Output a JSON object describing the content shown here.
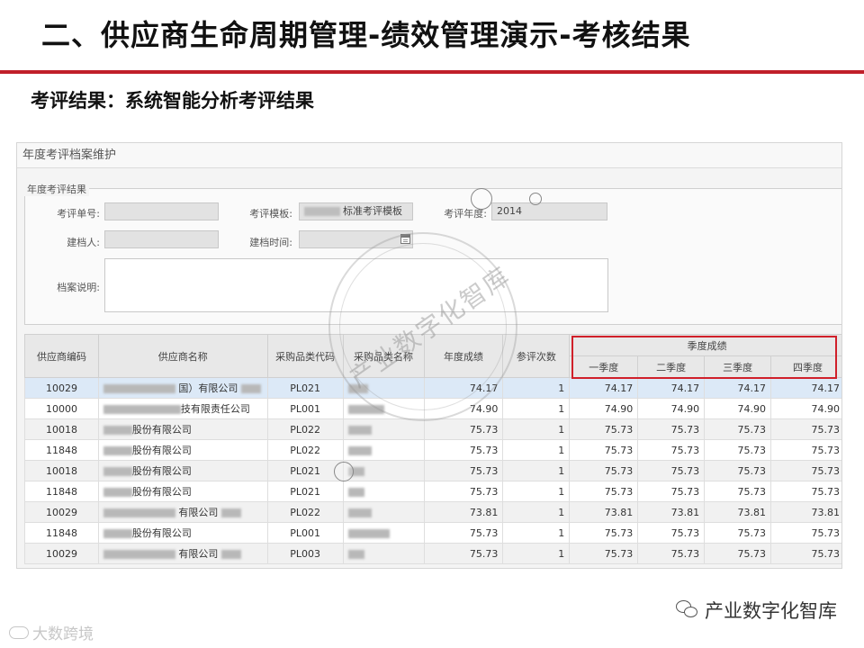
{
  "slide": {
    "title": "二、供应商生命周期管理-绩效管理演示-考核结果",
    "subtitle": "考评结果：系统智能分析考评结果"
  },
  "window": {
    "title": "年度考评档案维护",
    "section_legend": "年度考评结果"
  },
  "form": {
    "eval_no_label": "考评单号:",
    "eval_no_value": "",
    "template_label": "考评模板:",
    "template_value": "标准考评模板",
    "year_label": "考评年度:",
    "year_value": "2014",
    "creator_label": "建档人:",
    "creator_value": "",
    "created_time_label": "建档时间:",
    "created_time_value": "",
    "notes_label": "档案说明:",
    "notes_value": ""
  },
  "table": {
    "headers": {
      "supplier_code": "供应商编码",
      "supplier_name": "供应商名称",
      "category_code": "采购品类代码",
      "category_name": "采购品类名称",
      "annual_score": "年度成绩",
      "eval_count": "参评次数",
      "quarterly_group": "季度成绩",
      "q1": "一季度",
      "q2": "二季度",
      "q3": "三季度",
      "q4": "四季度"
    },
    "rows": [
      {
        "code": "10029",
        "name": "国）有限公司",
        "cat": "PL021",
        "annual": "74.17",
        "count": "1",
        "q1": "74.17",
        "q2": "74.17",
        "q3": "74.17",
        "q4": "74.17"
      },
      {
        "code": "10000",
        "name": "技有限责任公司",
        "cat": "PL001",
        "annual": "74.90",
        "count": "1",
        "q1": "74.90",
        "q2": "74.90",
        "q3": "74.90",
        "q4": "74.90"
      },
      {
        "code": "10018",
        "name": "股份有限公司",
        "cat": "PL022",
        "annual": "75.73",
        "count": "1",
        "q1": "75.73",
        "q2": "75.73",
        "q3": "75.73",
        "q4": "75.73"
      },
      {
        "code": "11848",
        "name": "股份有限公司",
        "cat": "PL022",
        "annual": "75.73",
        "count": "1",
        "q1": "75.73",
        "q2": "75.73",
        "q3": "75.73",
        "q4": "75.73"
      },
      {
        "code": "10018",
        "name": "股份有限公司",
        "cat": "PL021",
        "annual": "75.73",
        "count": "1",
        "q1": "75.73",
        "q2": "75.73",
        "q3": "75.73",
        "q4": "75.73"
      },
      {
        "code": "11848",
        "name": "股份有限公司",
        "cat": "PL021",
        "annual": "75.73",
        "count": "1",
        "q1": "75.73",
        "q2": "75.73",
        "q3": "75.73",
        "q4": "75.73"
      },
      {
        "code": "10029",
        "name": "有限公司",
        "cat": "PL022",
        "annual": "73.81",
        "count": "1",
        "q1": "73.81",
        "q2": "73.81",
        "q3": "73.81",
        "q4": "73.81"
      },
      {
        "code": "11848",
        "name": "股份有限公司",
        "cat": "PL001",
        "annual": "75.73",
        "count": "1",
        "q1": "75.73",
        "q2": "75.73",
        "q3": "75.73",
        "q4": "75.73"
      },
      {
        "code": "10029",
        "name": "有限公司",
        "cat": "PL003",
        "annual": "75.73",
        "count": "1",
        "q1": "75.73",
        "q2": "75.73",
        "q3": "75.73",
        "q4": "75.73"
      }
    ]
  },
  "watermarks": {
    "stamp_text": "产业数字化智库",
    "brand_text": "产业数字化智库",
    "corner_text": "大数跨境"
  },
  "colors": {
    "accent_red": "#c0202a",
    "highlight_red": "#d0202a",
    "selected_row": "#dce9f7"
  }
}
